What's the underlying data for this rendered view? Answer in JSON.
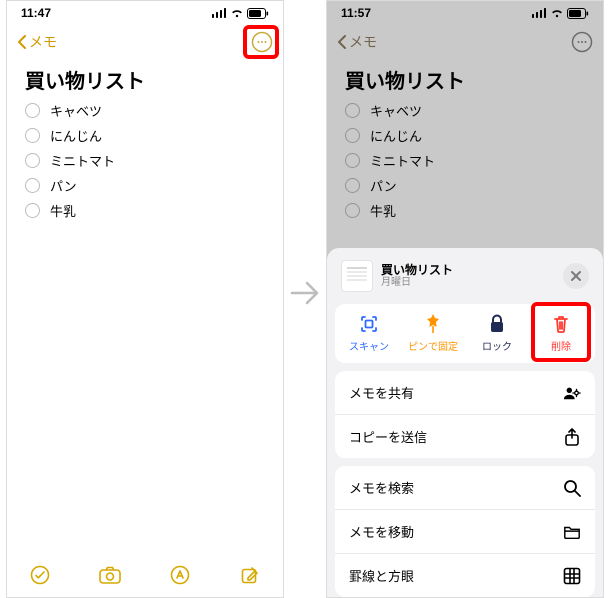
{
  "left": {
    "time": "11:47",
    "back_label": "メモ",
    "title": "買い物リスト",
    "items": [
      "キャベツ",
      "にんじん",
      "ミニトマト",
      "パン",
      "牛乳"
    ]
  },
  "right": {
    "time": "11:57",
    "back_label": "メモ",
    "title": "買い物リスト",
    "items": [
      "キャベツ",
      "にんじん",
      "ミニトマト",
      "パン",
      "牛乳"
    ],
    "sheet": {
      "title": "買い物リスト",
      "subtitle": "月曜日",
      "actions": {
        "scan": "スキャン",
        "pin": "ピンで固定",
        "lock": "ロック",
        "delete": "削除"
      },
      "menu1": {
        "share": "メモを共有",
        "send_copy": "コピーを送信"
      },
      "menu2": {
        "find": "メモを検索",
        "move": "メモを移動",
        "lines_grids": "罫線と方眼"
      }
    }
  }
}
